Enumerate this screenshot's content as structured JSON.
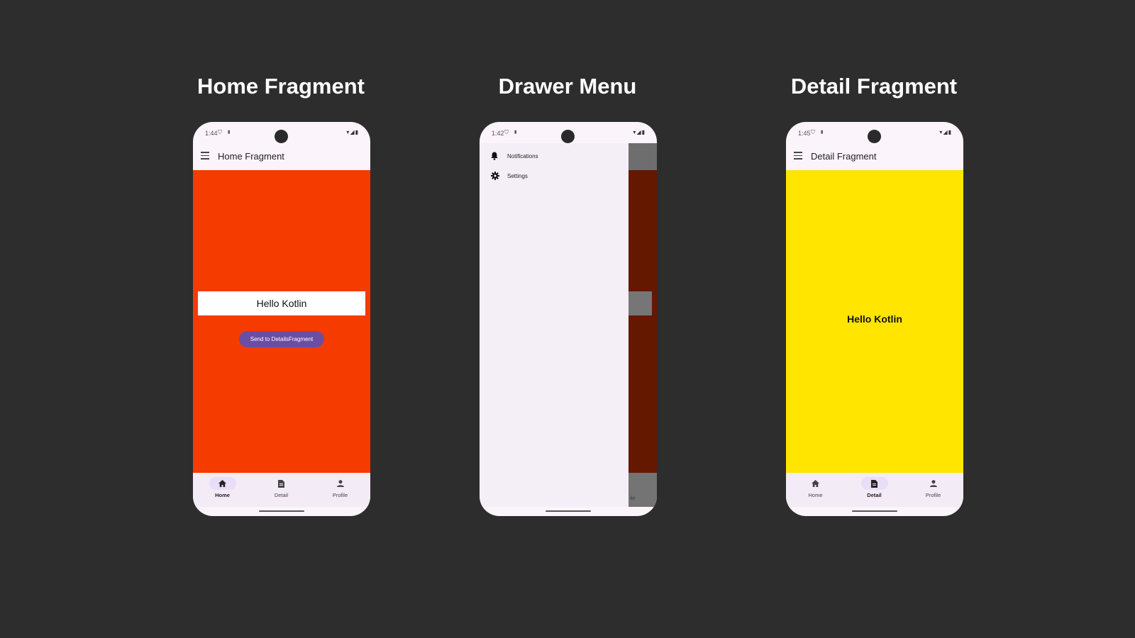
{
  "panels": [
    {
      "title": "Home Fragment",
      "status_time": "1:44",
      "toolbar_title": "Home Fragment",
      "content_color": "#f53b00",
      "text_field_value": "Hello Kotlin",
      "button_label": "Send to DetailsFragment",
      "nav": {
        "home": "Home",
        "detail": "Detail",
        "profile": "Profile",
        "active": "Home"
      }
    },
    {
      "title": "Drawer Menu",
      "status_time": "1:42",
      "drawer_items": [
        {
          "label": "Notifications",
          "icon": "bell-icon"
        },
        {
          "label": "Settings",
          "icon": "gear-icon"
        }
      ],
      "behind_nav_fragment": "ile",
      "content_color": "#641800"
    },
    {
      "title": "Detail Fragment",
      "status_time": "1:45",
      "toolbar_title": "Detail Fragment",
      "content_color": "#ffe500",
      "content_text": "Hello Kotlin",
      "nav": {
        "home": "Home",
        "detail": "Detail",
        "profile": "Profile",
        "active": "Detail"
      }
    }
  ],
  "colors": {
    "background": "#2d2d2d",
    "button": "#6a4ea3",
    "nav_active_pill": "#e9ddf7"
  }
}
